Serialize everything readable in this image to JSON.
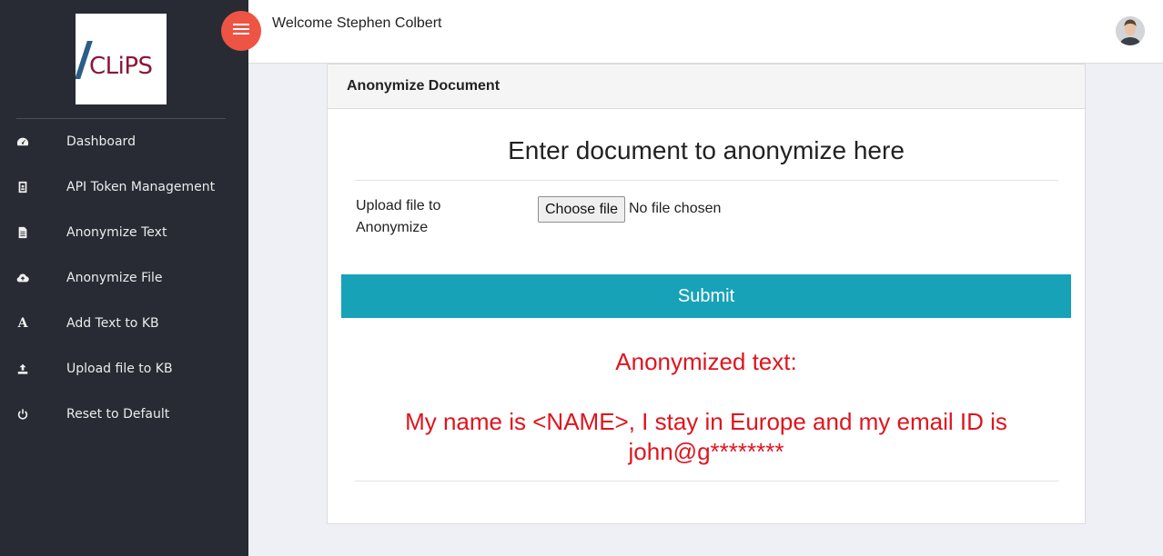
{
  "logo": {
    "text": "CLiPS"
  },
  "sidebar": {
    "items": [
      {
        "label": "Dashboard",
        "icon": "dashboard-icon"
      },
      {
        "label": "API Token Management",
        "icon": "badge-icon"
      },
      {
        "label": "Anonymize Text",
        "icon": "document-icon"
      },
      {
        "label": "Anonymize File",
        "icon": "cloud-upload-icon"
      },
      {
        "label": "Add Text to KB",
        "icon": "font-icon"
      },
      {
        "label": "Upload file to KB",
        "icon": "upload-icon"
      },
      {
        "label": "Reset to Default",
        "icon": "power-icon"
      }
    ]
  },
  "header": {
    "welcome": "Welcome Stephen Colbert"
  },
  "card": {
    "title": "Anonymize Document",
    "heading": "Enter document to anonymize here",
    "upload_label": "Upload file to Anonymize",
    "file_button": "Choose file",
    "file_status": "No file chosen",
    "submit_label": "Submit",
    "result_title": "Anonymized text:",
    "result_text": "My name is <NAME>, I stay in Europe and my email ID is john@g********"
  },
  "colors": {
    "sidebar_bg": "#282b34",
    "toggle_accent": "#ee5443",
    "submit_bg": "#17a2b8",
    "result_text": "#e0141e"
  }
}
